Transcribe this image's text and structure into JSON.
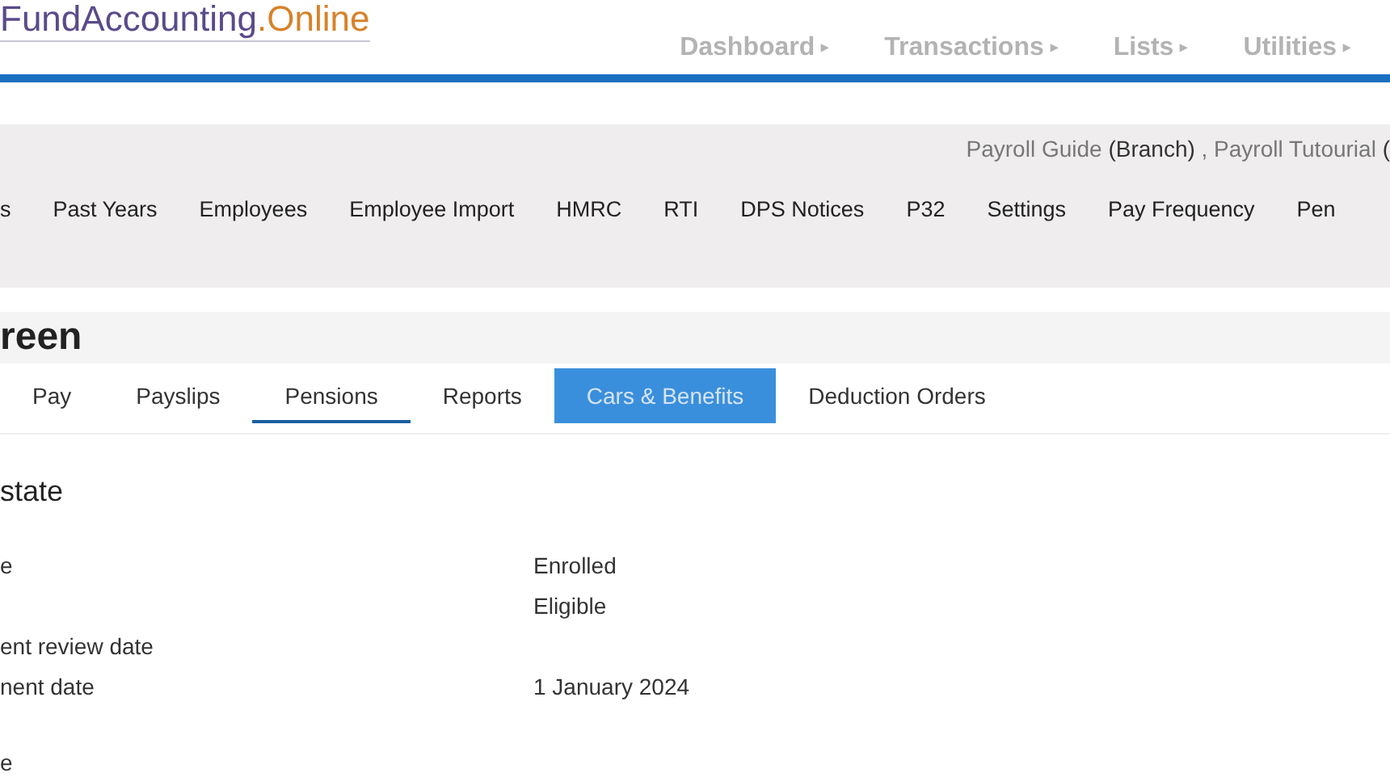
{
  "logo": {
    "name": "FundAccounting",
    "suffix": ".Online"
  },
  "top_nav": [
    {
      "label": "Dashboard",
      "caret": "▸"
    },
    {
      "label": "Transactions",
      "caret": "▸"
    },
    {
      "label": "Lists",
      "caret": "▸"
    },
    {
      "label": "Utilities",
      "caret": "▸"
    }
  ],
  "company_line": {
    "company": "Payroll Guide",
    "company_type": "(Branch)",
    "separator": ",",
    "payroll": "Payroll Tutourial",
    "rest": "("
  },
  "menu": [
    "s",
    "Past Years",
    "Employees",
    "Employee Import",
    "HMRC",
    "RTI",
    "DPS Notices",
    "P32",
    "Settings",
    "Pay Frequency",
    "Pen"
  ],
  "page_title": "reen",
  "tabs": [
    {
      "label": "Pay",
      "selected": false,
      "highlighted": false
    },
    {
      "label": "Payslips",
      "selected": false,
      "highlighted": false
    },
    {
      "label": "Pensions",
      "selected": true,
      "highlighted": false
    },
    {
      "label": "Reports",
      "selected": false,
      "highlighted": false
    },
    {
      "label": "Cars & Benefits",
      "selected": false,
      "highlighted": true
    },
    {
      "label": "Deduction Orders",
      "selected": false,
      "highlighted": false
    }
  ],
  "section_title": "state",
  "fields": [
    {
      "label": "e",
      "value": "Enrolled"
    },
    {
      "value": "Eligible"
    },
    {
      "label": "ent review date"
    },
    {
      "label": "nent date",
      "value": "1 January 2024"
    },
    {
      "label": "e"
    }
  ]
}
